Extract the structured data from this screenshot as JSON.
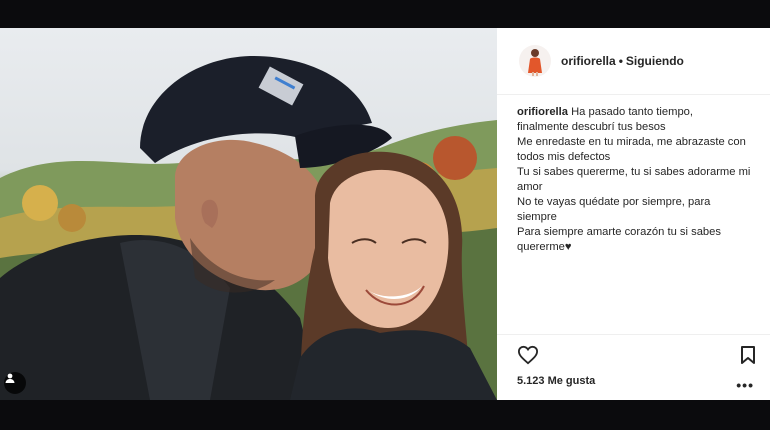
{
  "post": {
    "username": "orifiorella",
    "follow_status": "Siguiendo",
    "separator": "•",
    "caption": {
      "username": "orifiorella",
      "lines": [
        "Ha pasado tanto tiempo,",
        "finalmente descubrí tus besos",
        "Me enredaste en tu mirada, me abrazaste con",
        "todos mis defectos",
        "Tu si sabes quererme, tu si sabes adorarme mi",
        "amor",
        "No te vayas quédate por siempre, para",
        "siempre",
        "Para siempre amarte corazón tu si sabes",
        "quererme♥"
      ]
    },
    "likes_text": "5.123 Me gusta",
    "more_label": "•••"
  },
  "icons": {
    "heart": "heart-outline-icon",
    "bookmark": "bookmark-outline-icon",
    "user_tag": "user-tag-icon",
    "avatar": "profile-avatar"
  },
  "colors": {
    "background": "#0b0b0d",
    "text": "#262626",
    "divider": "#efefef"
  }
}
